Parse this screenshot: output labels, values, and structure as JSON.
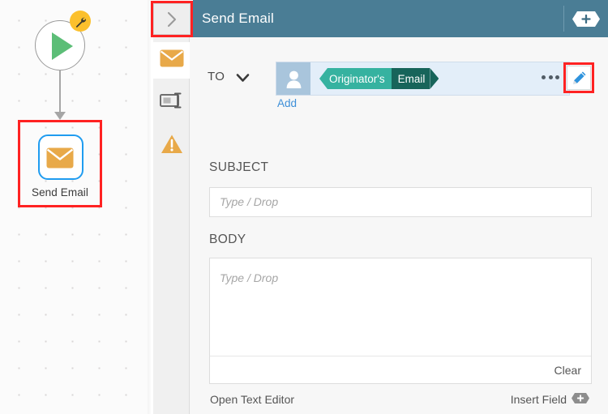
{
  "canvas": {
    "start_node": {
      "icon": "play-icon",
      "badge_icon": "wrench-icon"
    },
    "send_email_node": {
      "label": "Send Email",
      "icon": "envelope-icon"
    },
    "highlight_color": "#ff2222"
  },
  "toggle": {
    "icon": "chevron-right-icon"
  },
  "header": {
    "title": "Send Email",
    "background": "#4a7d95",
    "add_icon": "hex-plus-icon"
  },
  "rail": {
    "items": [
      {
        "name": "mail",
        "icon": "envelope-icon",
        "active": true
      },
      {
        "name": "field",
        "icon": "input-field-icon",
        "active": false
      },
      {
        "name": "warning",
        "icon": "warning-triangle-icon",
        "active": false
      }
    ]
  },
  "form": {
    "to": {
      "label": "TO",
      "caret_icon": "chevron-down-icon",
      "avatar_icon": "person-icon",
      "chip": {
        "primary": "Originator's",
        "secondary": "Email"
      },
      "more_icon": "ellipsis-icon",
      "add_link": "Add",
      "edit_icon": "pencil-icon",
      "edit_highlighted": true
    },
    "subject": {
      "label": "SUBJECT",
      "value": "",
      "placeholder": "Type / Drop"
    },
    "body": {
      "label": "BODY",
      "value": "",
      "placeholder": "Type / Drop",
      "clear_label": "Clear"
    },
    "footer": {
      "open_editor_label": "Open Text Editor",
      "insert_field_label": "Insert Field",
      "insert_field_icon": "hex-plus-icon"
    }
  },
  "colors": {
    "header_blue": "#4a7d95",
    "chip_teal": "#36b2a0",
    "chip_dark_teal": "#17645a",
    "accent_orange": "#e8a949",
    "node_blue": "#1f9cf0",
    "play_green": "#5cbe77",
    "link_blue": "#3d8fd8",
    "highlight_red": "#ff2222"
  }
}
